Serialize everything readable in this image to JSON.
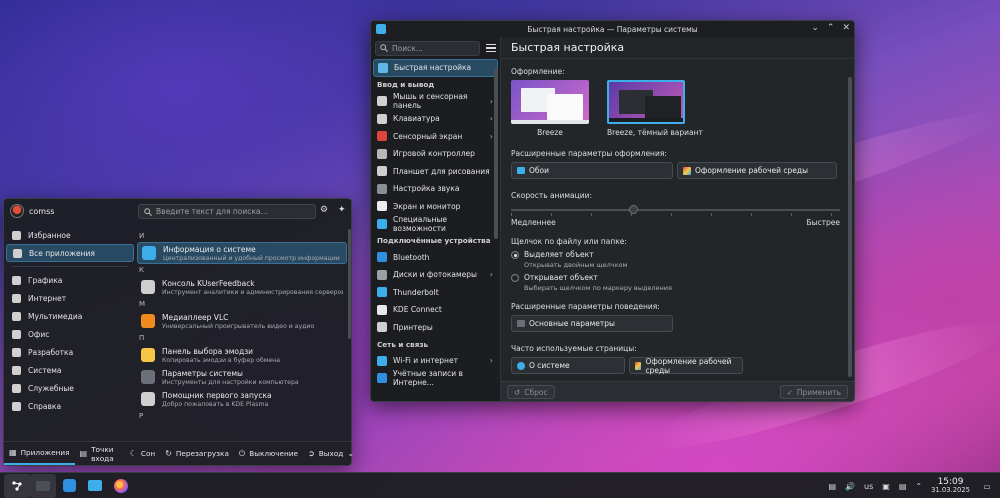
{
  "settings": {
    "title": "Быстрая настройка — Параметры системы",
    "search_placeholder": "Поиск...",
    "page_title": "Быстрая настройка",
    "sidebar": [
      {
        "type": "item",
        "label": "Быстрая настройка",
        "active": true,
        "color": "#5fb8e8"
      },
      {
        "type": "head",
        "label": "Ввод и вывод"
      },
      {
        "type": "item",
        "label": "Мышь и сенсорная панель",
        "chevron": true,
        "color": "#d0d0d0"
      },
      {
        "type": "item",
        "label": "Клавиатура",
        "chevron": true,
        "color": "#d0d0d0"
      },
      {
        "type": "item",
        "label": "Сенсорный экран",
        "chevron": true,
        "color": "#e0453c"
      },
      {
        "type": "item",
        "label": "Игровой контроллер",
        "color": "#b8b8b8"
      },
      {
        "type": "item",
        "label": "Планшет для рисования",
        "color": "#cfcfcf"
      },
      {
        "type": "item",
        "label": "Настройка звука",
        "color": "#8a8f95"
      },
      {
        "type": "item",
        "label": "Экран и монитор",
        "color": "#ededed"
      },
      {
        "type": "item",
        "label": "Специальные возможности",
        "color": "#3daee9"
      },
      {
        "type": "head",
        "label": "Подключённые устройства"
      },
      {
        "type": "item",
        "label": "Bluetooth",
        "color": "#2f8fe0"
      },
      {
        "type": "item",
        "label": "Диски и фотокамеры",
        "chevron": true,
        "color": "#9aa0a6"
      },
      {
        "type": "item",
        "label": "Thunderbolt",
        "color": "#3daee9"
      },
      {
        "type": "item",
        "label": "KDE Connect",
        "color": "#e8e8e8"
      },
      {
        "type": "item",
        "label": "Принтеры",
        "color": "#cfcfcf"
      },
      {
        "type": "head",
        "label": "Сеть и связь"
      },
      {
        "type": "item",
        "label": "Wi-Fi и интернет",
        "chevron": true,
        "color": "#3daee9"
      },
      {
        "type": "item",
        "label": "Учётные записи в Интерне...",
        "color": "#2f8fe0"
      }
    ],
    "appearance_label": "Оформление:",
    "theme_light": "Breeze",
    "theme_dark": "Breeze, тёмный вариант",
    "adv_appearance_label": "Расширенные параметры оформления:",
    "btn_wallpaper": "Обои",
    "btn_workspace_theme": "Оформление рабочей среды",
    "anim_label": "Скорость анимации:",
    "anim_value": 0.37,
    "slower": "Медленнее",
    "faster": "Быстрее",
    "click_label": "Щелчок по файлу или папке:",
    "opt1": "Выделяет объект",
    "opt1_sub": "Открывать двойным щелчком",
    "opt2": "Открывает объект",
    "opt2_sub": "Выбирать щелчком по маркеру выделения",
    "adv_behavior_label": "Расширенные параметры поведения:",
    "btn_general": "Основные параметры",
    "frequent_label": "Часто используемые страницы:",
    "btn_about": "О системе",
    "btn_workspace_theme2": "Оформление рабочей среды",
    "reset": "Сброс",
    "apply": "Применить"
  },
  "launcher": {
    "user": "comss",
    "search_placeholder": "Введите текст для поиска...",
    "categories_top": [
      {
        "label": "Избранное",
        "color": "#cfcfcf"
      },
      {
        "label": "Все приложения",
        "active": true,
        "color": "#cfcfcf"
      }
    ],
    "categories": [
      {
        "label": "Графика",
        "color": "#d0d0d0"
      },
      {
        "label": "Интернет",
        "color": "#d0d0d0"
      },
      {
        "label": "Мультимедиа",
        "color": "#d0d0d0"
      },
      {
        "label": "Офис",
        "color": "#d0d0d0"
      },
      {
        "label": "Разработка",
        "color": "#d0d0d0"
      },
      {
        "label": "Система",
        "color": "#d0d0d0"
      },
      {
        "label": "Служебные",
        "color": "#d0d0d0"
      },
      {
        "label": "Справка",
        "color": "#d0d0d0"
      }
    ],
    "groups": [
      {
        "letter": "И",
        "apps": [
          {
            "name": "Информация о системе",
            "desc": "Централизованный и удобный просмотр информации о си...",
            "active": true,
            "color": "#3daee9"
          }
        ]
      },
      {
        "letter": "К",
        "apps": [
          {
            "name": "Консоль KUserFeedback",
            "desc": "Инструмент аналитики и администрирования серверов KU...",
            "color": "#cfcfcf"
          }
        ]
      },
      {
        "letter": "М",
        "apps": [
          {
            "name": "Медиаплеер VLC",
            "desc": "Универсальный проигрыватель видео и аудио",
            "color": "#f08a1c"
          }
        ]
      },
      {
        "letter": "П",
        "apps": [
          {
            "name": "Панель выбора эмодзи",
            "desc": "Копировать эмодзи в буфер обмена",
            "color": "#f6c744"
          },
          {
            "name": "Параметры системы",
            "desc": "Инструменты для настройки компьютера",
            "color": "#6b7078"
          },
          {
            "name": "Помощник первого запуска",
            "desc": "Добро пожаловать в KDE Plasma",
            "color": "#cfcfcf"
          }
        ]
      },
      {
        "letter": "Р",
        "apps": []
      }
    ],
    "bottom": {
      "apps": "Приложения",
      "places": "Точки входа",
      "sleep": "Сон",
      "reboot": "Перезагрузка",
      "shutdown": "Выключение",
      "logout": "Выход"
    }
  },
  "taskbar": {
    "lang": "us",
    "time": "15:09",
    "date": "31.03.2025"
  }
}
